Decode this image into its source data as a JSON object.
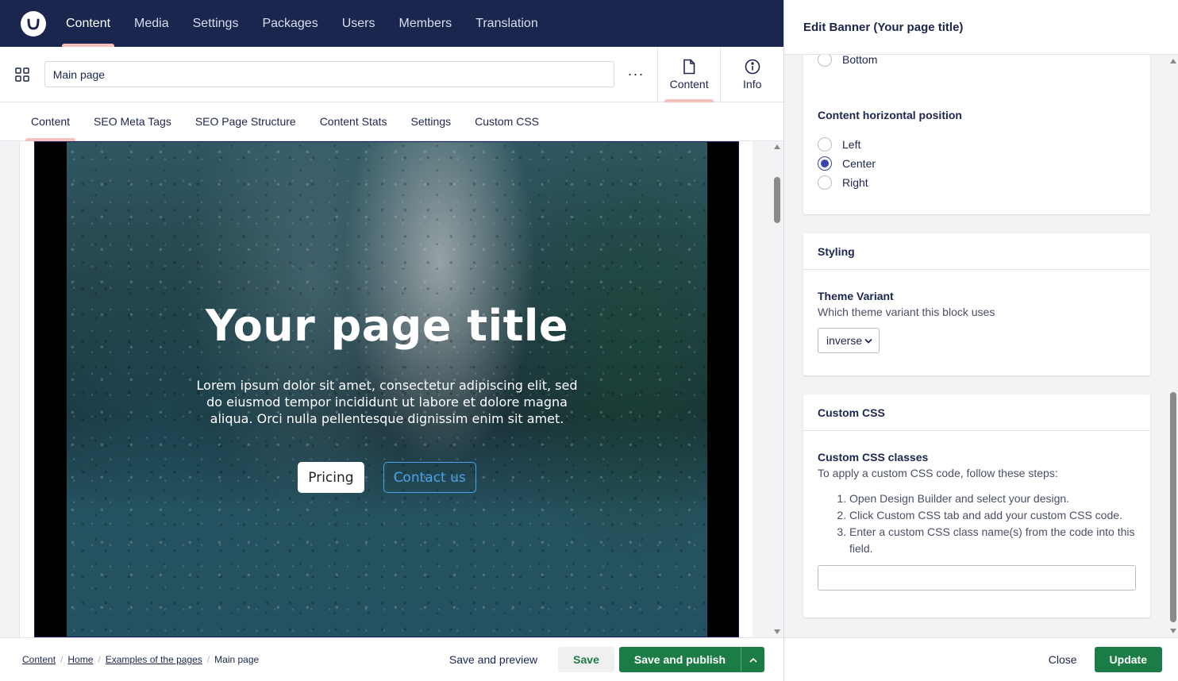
{
  "topnav": {
    "items": [
      "Content",
      "Media",
      "Settings",
      "Packages",
      "Users",
      "Members",
      "Translation"
    ],
    "active": "Content"
  },
  "header": {
    "name_value": "Main page",
    "more_label": "···",
    "apps": [
      {
        "label": "Content",
        "icon": "document-icon",
        "active": true
      },
      {
        "label": "Info",
        "icon": "info-icon",
        "active": false
      }
    ]
  },
  "tabs": [
    "Content",
    "SEO Meta Tags",
    "SEO Page Structure",
    "Content Stats",
    "Settings",
    "Custom CSS"
  ],
  "banner": {
    "title": "Your page title",
    "text": "Lorem ipsum dolor sit amet, consectetur adipiscing elit, sed do eiusmod tempor incididunt ut labore et dolore magna aliqua. Orci nulla pellentesque dignissim enim sit amet.",
    "primary_button": "Pricing",
    "secondary_button": "Contact us"
  },
  "footer": {
    "breadcrumbs": [
      "Content",
      "Home",
      "Examples of the pages"
    ],
    "current": "Main page",
    "save_preview": "Save and preview",
    "save": "Save",
    "save_publish": "Save and publish"
  },
  "panel": {
    "title": "Edit Banner (Your page title)",
    "partial_option": "Bottom",
    "h_position": {
      "label": "Content horizontal position",
      "options": [
        "Left",
        "Center",
        "Right"
      ],
      "selected": "Center"
    },
    "styling": {
      "title": "Styling",
      "theme_label": "Theme Variant",
      "theme_desc": "Which theme variant this block uses",
      "theme_value": "inverse"
    },
    "custom_css": {
      "title": "Custom CSS",
      "label": "Custom CSS classes",
      "desc": "To apply a custom CSS code, follow these steps:",
      "steps": [
        "Open Design Builder and select your design.",
        "Click Custom CSS tab and add your custom CSS code.",
        "Enter a custom CSS class name(s) from the code into this field."
      ],
      "value": ""
    },
    "close": "Close",
    "update": "Update"
  },
  "colors": {
    "nav_bg": "#1b264f",
    "accent": "#f5c1bc",
    "publish_green": "#1b7c46",
    "radio_selected": "#3544b1"
  }
}
